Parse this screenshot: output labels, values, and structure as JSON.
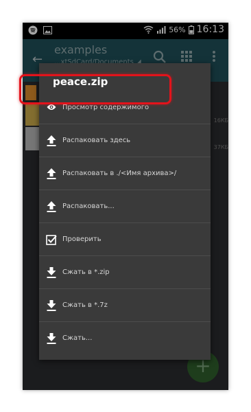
{
  "status_bar": {
    "battery": "56%",
    "time": "16:13"
  },
  "toolbar": {
    "title": "examples",
    "path": "...xtSdCard/Documents"
  },
  "background": {
    "sizes": [
      "16КБ",
      "37КБ"
    ]
  },
  "dialog": {
    "title": "peace.zip",
    "items": [
      {
        "label": "Просмотр содержимого",
        "icon": "eye-icon"
      },
      {
        "label": "Распаковать здесь",
        "icon": "extract-up-icon"
      },
      {
        "label": "Распаковать в ./<Имя архива>/",
        "icon": "extract-up-icon"
      },
      {
        "label": "Распаковать...",
        "icon": "extract-up-icon"
      },
      {
        "label": "Проверить",
        "icon": "checkbox-icon"
      },
      {
        "label": "Сжать в *.zip",
        "icon": "compress-down-icon"
      },
      {
        "label": "Сжать в *.7z",
        "icon": "compress-down-icon"
      },
      {
        "label": "Сжать...",
        "icon": "compress-down-icon"
      }
    ]
  },
  "colors": {
    "toolbar": "#1f4f58",
    "highlight": "#e3131b",
    "dialog_bg": "#3a3a3a"
  }
}
